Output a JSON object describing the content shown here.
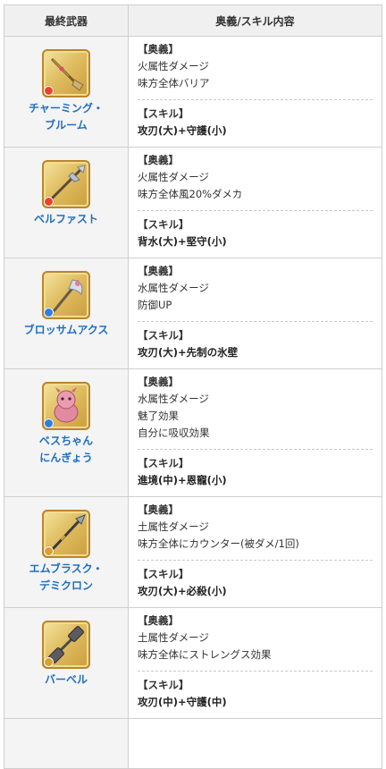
{
  "header": {
    "col_weapon": "最終武器",
    "col_content": "奥義/スキル内容"
  },
  "rows": [
    {
      "name_lines": [
        "チャーミング・",
        "ブルーム"
      ],
      "icon": "broom-icon",
      "element_color": "#e8442a",
      "ougi_head": "【奥義】",
      "ougi": [
        "火属性ダメージ",
        "味方全体バリア"
      ],
      "skill_head": "【スキル】",
      "skill": "攻刃(大)+守護(小)"
    },
    {
      "name_lines": [
        "ベルファスト"
      ],
      "icon": "halberd-icon",
      "element_color": "#e8442a",
      "ougi_head": "【奥義】",
      "ougi": [
        "火属性ダメージ",
        "味方全体風20%ダメカ"
      ],
      "skill_head": "【スキル】",
      "skill": "背水(大)+堅守(小)"
    },
    {
      "name_lines": [
        "ブロッサムアクス"
      ],
      "icon": "axe-icon",
      "element_color": "#2f7fe0",
      "ougi_head": "【奥義】",
      "ougi": [
        "水属性ダメージ",
        "防御UP"
      ],
      "skill_head": "【スキル】",
      "skill": "攻刃(大)+先制の氷壁"
    },
    {
      "name_lines": [
        "ベスちゃん",
        "にんぎょう"
      ],
      "icon": "doll-icon",
      "element_color": "#2f7fe0",
      "ougi_head": "【奥義】",
      "ougi": [
        "水属性ダメージ",
        "魅了効果",
        "自分に吸収効果"
      ],
      "skill_head": "【スキル】",
      "skill": "進境(中)+恩寵(小)"
    },
    {
      "name_lines": [
        "エムブラスク・",
        "デミクロン"
      ],
      "icon": "spear-icon",
      "element_color": "#d9a030",
      "ougi_head": "【奥義】",
      "ougi": [
        "土属性ダメージ",
        "味方全体にカウンター(被ダメ/1回)"
      ],
      "skill_head": "【スキル】",
      "skill": "攻刃(大)+必殺(小)"
    },
    {
      "name_lines": [
        "バーベル"
      ],
      "icon": "barbell-icon",
      "element_color": "#d9a030",
      "ougi_head": "【奥義】",
      "ougi": [
        "土属性ダメージ",
        "味方全体にストレングス効果"
      ],
      "skill_head": "【スキル】",
      "skill": "攻刃(中)+守護(中)"
    }
  ]
}
